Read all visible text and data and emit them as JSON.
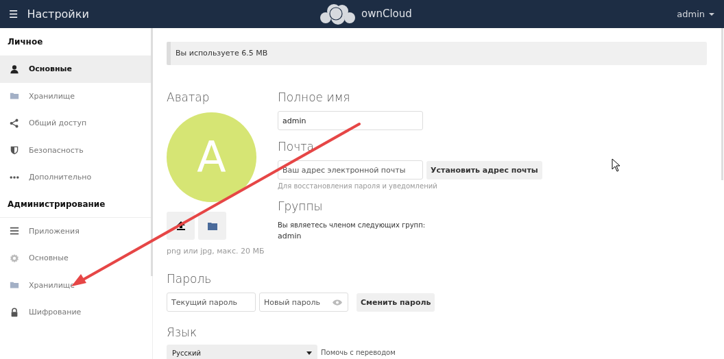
{
  "header": {
    "menu_icon": "☰",
    "title": "Настройки",
    "brand": "ownCloud",
    "user": "admin"
  },
  "sidebar": {
    "sections": [
      {
        "title": "Личное",
        "items": [
          {
            "label": "Основные",
            "kind": "person",
            "selected": true
          },
          {
            "label": "Хранилище",
            "kind": "folder",
            "selected": false
          },
          {
            "label": "Общий доступ",
            "kind": "share",
            "selected": false
          },
          {
            "label": "Безопасность",
            "kind": "shield",
            "selected": false
          },
          {
            "label": "Дополнительно",
            "kind": "dots",
            "selected": false
          }
        ]
      },
      {
        "title": "Администрирование",
        "items": [
          {
            "label": "Приложения",
            "kind": "list",
            "selected": false
          },
          {
            "label": "Основные",
            "kind": "gear",
            "selected": false
          },
          {
            "label": "Хранилище",
            "kind": "folder",
            "selected": false
          },
          {
            "label": "Шифрование",
            "kind": "lock",
            "selected": false
          }
        ]
      }
    ]
  },
  "quota": {
    "text": "Вы используете 6.5 MB"
  },
  "avatar": {
    "title": "Аватар",
    "letter": "A",
    "color": "#d6e574",
    "hint": "png или jpg, макс. 20 МБ"
  },
  "full_name": {
    "title": "Полное имя",
    "value": "admin"
  },
  "email": {
    "title": "Почта",
    "placeholder": "Ваш адрес электронной почты",
    "button": "Установить адрес почты",
    "hint": "Для восстановления пароля и уведомлений"
  },
  "groups": {
    "title": "Группы",
    "text": "Вы являетесь членом следующих групп:",
    "value": "admin"
  },
  "password": {
    "title": "Пароль",
    "current_placeholder": "Текущий пароль",
    "new_placeholder": "Новый пароль",
    "button": "Сменить пароль"
  },
  "language": {
    "title": "Язык",
    "value": "Русский",
    "link": "Помочь с переводом"
  }
}
